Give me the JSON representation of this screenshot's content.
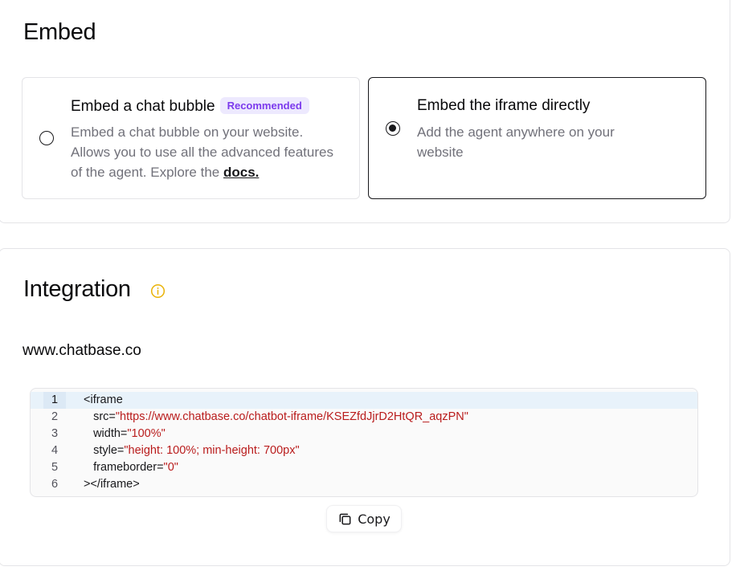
{
  "embed": {
    "title": "Embed",
    "options": [
      {
        "title": "Embed a chat bubble",
        "badge": "Recommended",
        "desc": "Embed a chat bubble on your website. Allows you to use all the advanced features of the agent. Explore the ",
        "link": "docs.",
        "selected": false
      },
      {
        "title": "Embed the iframe directly",
        "desc": "Add the agent anywhere on your website",
        "selected": true
      }
    ]
  },
  "integration": {
    "title": "Integration",
    "info_icon": "info-circle-icon",
    "domain": "www.chatbase.co",
    "code": {
      "active_line": 1,
      "lines": [
        {
          "num": "1",
          "prefix": "<iframe",
          "value": "",
          "suffix": ""
        },
        {
          "num": "2",
          "prefix": "   src=",
          "value": "\"https://www.chatbase.co/chatbot-iframe/KSEZfdJjrD2HtQR_aqzPN\"",
          "suffix": ""
        },
        {
          "num": "3",
          "prefix": "   width=",
          "value": "\"100%\"",
          "suffix": ""
        },
        {
          "num": "4",
          "prefix": "   style=",
          "value": "\"height: 100%; min-height: 700px\"",
          "suffix": ""
        },
        {
          "num": "5",
          "prefix": "   frameborder=",
          "value": "\"0\"",
          "suffix": ""
        },
        {
          "num": "6",
          "prefix": "></iframe>",
          "value": "",
          "suffix": ""
        }
      ]
    },
    "copy_label": "Copy",
    "copy_icon": "copy-icon"
  },
  "colors": {
    "accent_badge": "#7c3aed",
    "badge_bg": "#ede9fe",
    "string": "#b91c1c",
    "info_icon": "#eab308"
  }
}
